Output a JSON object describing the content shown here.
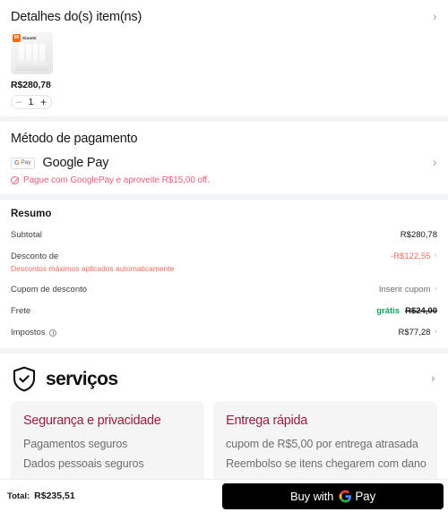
{
  "item_details": {
    "title": "Detalhes do(s) item(ns)",
    "chevron": "›",
    "product": {
      "brand": "Xiaomi",
      "brand_mark": "Mi",
      "price": "R$280,78",
      "quantity": "1",
      "minus": "–",
      "plus": "+"
    }
  },
  "payment": {
    "title": "Método de pagamento",
    "method_name": "Google Pay",
    "badge_g": "G",
    "badge_pay": "Pay",
    "chevron": "›",
    "promo_text": "Pague com GooglePay e aproveite R$15,00 off."
  },
  "summary": {
    "heading": "Resumo",
    "rows": [
      {
        "label": "Subtotal",
        "sublabel": "",
        "value": "R$280,78",
        "chevron": "",
        "style": "plain"
      },
      {
        "label": "Desconto de",
        "sublabel": "Descontos máximos aplicados automaticamente",
        "value": "-R$122,55",
        "chevron": "›",
        "style": "negative"
      },
      {
        "label": "Cupom de desconto",
        "sublabel": "",
        "value": "Inserir cupom",
        "chevron": "›",
        "style": "muted"
      },
      {
        "label": "Frete",
        "sublabel": "",
        "value_free": "grátis",
        "value_struck": "R$24,00",
        "chevron": "",
        "style": "shipping"
      },
      {
        "label": "Impostos",
        "sublabel": "",
        "value": "R$77,28",
        "chevron": "›",
        "style": "plain",
        "info_icon": true
      }
    ]
  },
  "services": {
    "title": "serviços",
    "chevron": "›",
    "cards": [
      {
        "title": "Segurança e privacidade",
        "lines": [
          "Pagamentos seguros",
          "Dados pessoais seguros"
        ]
      },
      {
        "title": "Entrega rápida",
        "lines": [
          "cupom de R$5,00 por entrega atrasada",
          "Reembolso se itens chegarem com dano"
        ]
      }
    ]
  },
  "footer": {
    "total_label": "Total:",
    "total_value": "R$235,51",
    "buy_label": "Buy with",
    "buy_pay_word": "Pay"
  },
  "colors": {
    "accent_red": "#e8607a",
    "discount_red": "#f26b5a",
    "card_title": "#9c1c3a",
    "free_green": "#12a05c",
    "brand_orange": "#ff6900",
    "button_black": "#000000"
  }
}
